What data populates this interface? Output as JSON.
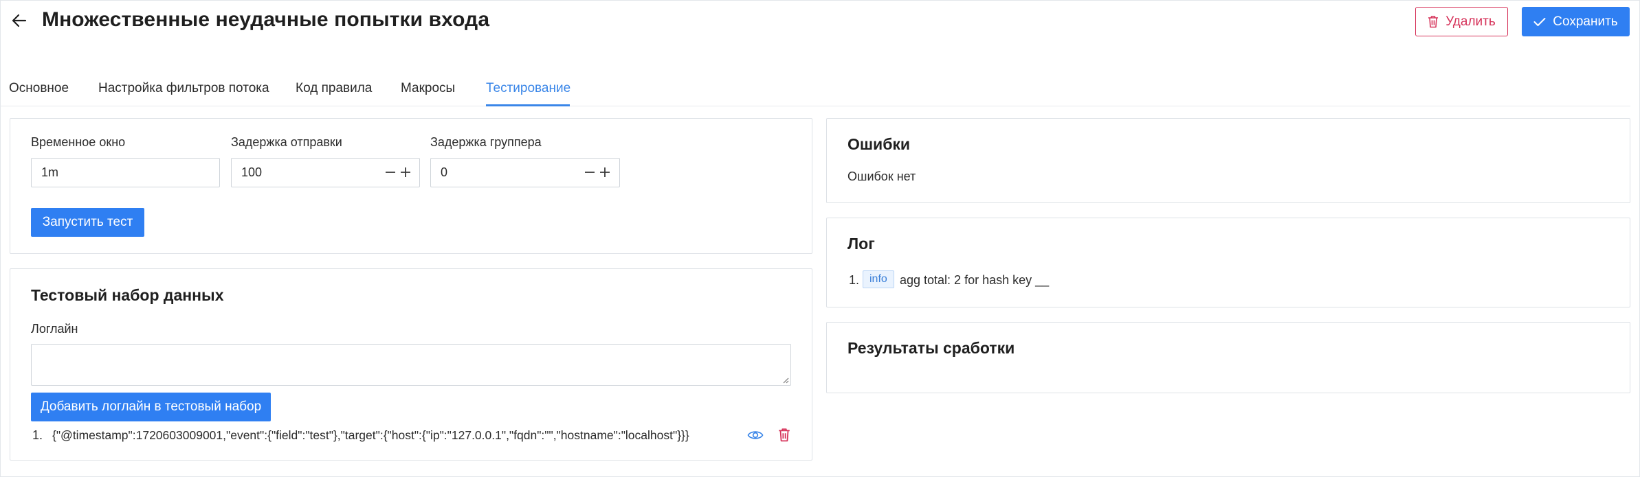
{
  "header": {
    "title": "Множественные неудачные попытки входа",
    "delete_label": "Удалить",
    "save_label": "Сохранить",
    "colors": {
      "primary": "#2f7ff2",
      "danger": "#d6335a",
      "active_tab": "#3a86e8"
    }
  },
  "tabs": [
    {
      "label": "Основное",
      "active": false
    },
    {
      "label": "Настройка фильтров потока",
      "active": false
    },
    {
      "label": "Код правила",
      "active": false
    },
    {
      "label": "Макросы",
      "active": false
    },
    {
      "label": "Тестирование",
      "active": true
    }
  ],
  "settings": {
    "time_window": {
      "label": "Временное окно",
      "value": "1m"
    },
    "send_delay": {
      "label": "Задержка отправки",
      "value": "100"
    },
    "grouper_delay": {
      "label": "Задержка группера",
      "value": "0"
    },
    "run_test_label": "Запустить тест"
  },
  "dataset": {
    "title": "Тестовый набор данных",
    "logline_label": "Логлайн",
    "logline_value": "",
    "add_button_label": "Добавить логлайн в тестовый набор",
    "items": [
      {
        "index": "1.",
        "text": "{\"@timestamp\":1720603009001,\"event\":{\"field\":\"test\"},\"target\":{\"host\":{\"ip\":\"127.0.0.1\",\"fqdn\":\"\",\"hostname\":\"localhost\"}}}"
      }
    ]
  },
  "errors": {
    "title": "Ошибки",
    "message": "Ошибок нет"
  },
  "log": {
    "title": "Лог",
    "entries": [
      {
        "index": "1.",
        "level": "info",
        "text": "agg total: 2 for hash key __"
      }
    ]
  },
  "results": {
    "title": "Результаты сработки"
  },
  "icons": {
    "back": "arrow-left-icon",
    "delete": "trash-icon",
    "save": "check-icon",
    "minus": "minus-icon",
    "plus": "plus-icon",
    "view": "eye-icon",
    "remove": "trash-icon"
  }
}
